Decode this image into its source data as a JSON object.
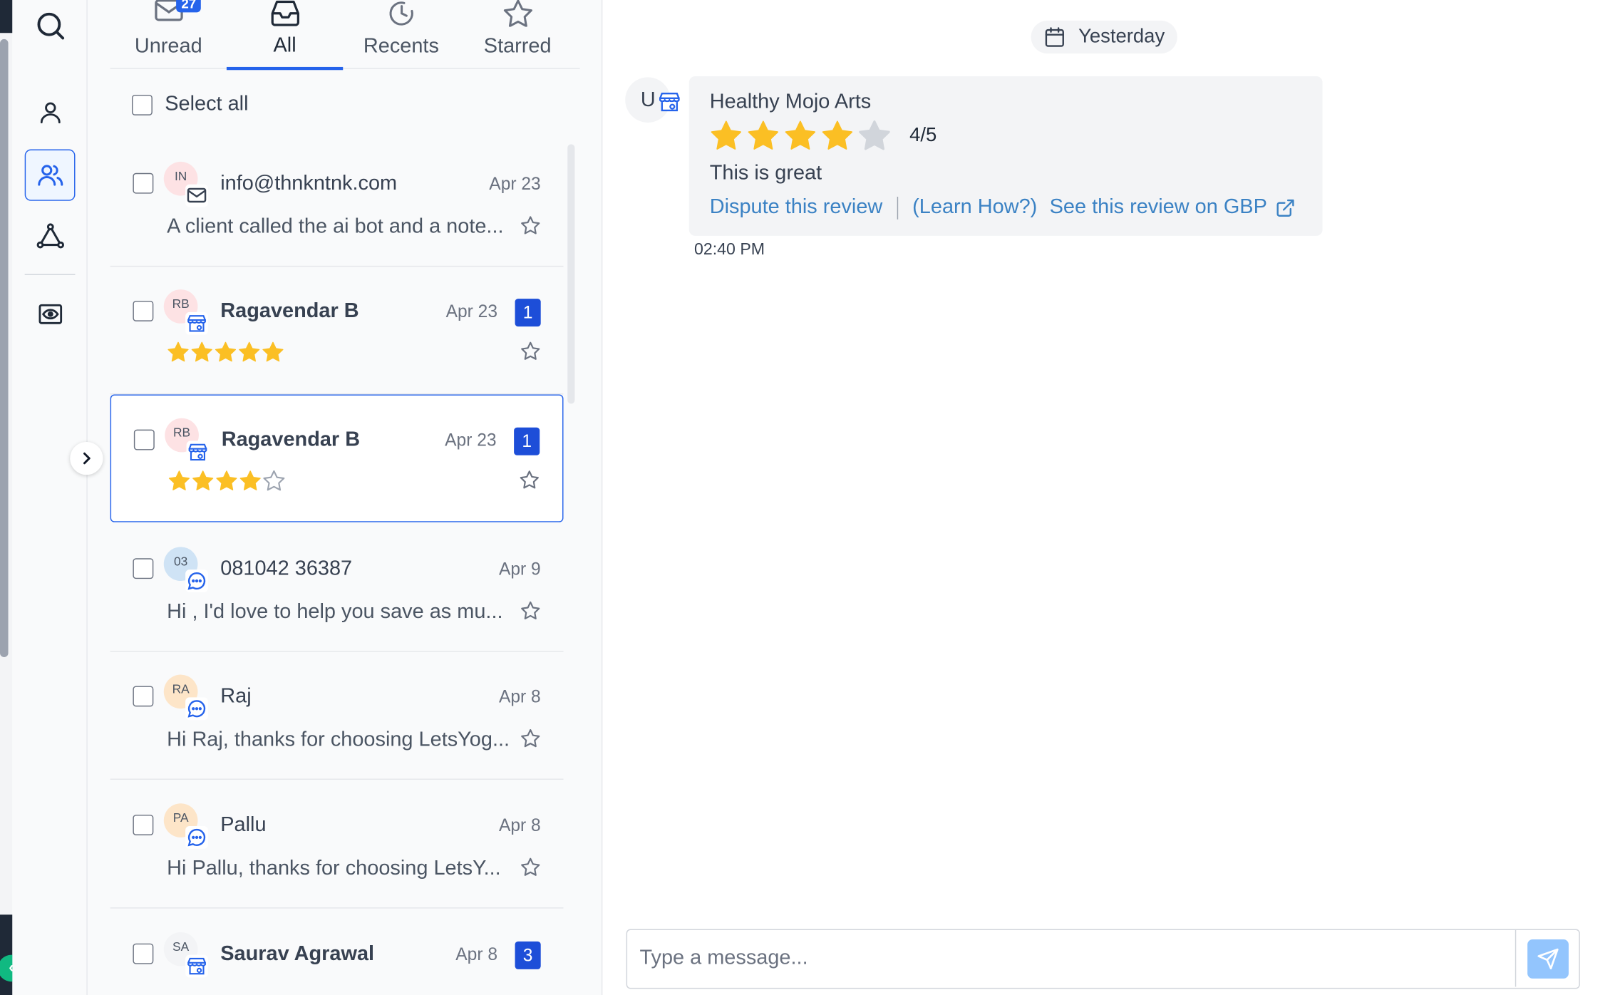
{
  "nav": {
    "icons": [
      "search-icon",
      "user-icon",
      "users-icon",
      "network-icon",
      "eye-icon"
    ],
    "active": "users-icon",
    "accent": "#2563eb"
  },
  "tabs": [
    {
      "label": "Unread",
      "badge": "27",
      "icon": "mail-icon"
    },
    {
      "label": "All",
      "icon": "inbox-icon",
      "active": true
    },
    {
      "label": "Recents",
      "icon": "clock-icon"
    },
    {
      "label": "Starred",
      "icon": "star-icon"
    }
  ],
  "select_all_label": "Select all",
  "conversations": [
    {
      "initials": "IN",
      "name": "info@thnkntnk.com",
      "date": "Apr 23",
      "preview": "A client called the ai bot and a note...",
      "channel": "mail-icon",
      "avatar_color": "#fde2e4"
    },
    {
      "initials": "RB",
      "name": "Ragavendar B",
      "date": "Apr 23",
      "count": "1",
      "rating": 5,
      "channel": "store-icon",
      "avatar_color": "#fde2e4"
    },
    {
      "initials": "RB",
      "name": "Ragavendar B",
      "date": "Apr 23",
      "count": "1",
      "rating": 4,
      "channel": "store-icon",
      "avatar_color": "#fde2e4"
    },
    {
      "initials": "03",
      "name": "081042 36387",
      "date": "Apr 9",
      "preview": "Hi , I'd love to help you save as mu...",
      "channel": "chat-icon",
      "avatar_color": "#cfe3f5"
    },
    {
      "initials": "RA",
      "name": "Raj",
      "date": "Apr 8",
      "preview": "Hi Raj, thanks for choosing LetsYog...",
      "channel": "chat-icon",
      "avatar_color": "#fde5c8"
    },
    {
      "initials": "PA",
      "name": "Pallu",
      "date": "Apr 8",
      "preview": "Hi Pallu, thanks for choosing LetsY...",
      "channel": "chat-icon",
      "avatar_color": "#fde5c8"
    },
    {
      "initials": "SA",
      "name": "Saurav Agrawal",
      "date": "Apr 8",
      "count": "3",
      "channel": "store-icon",
      "avatar_color": "#f3f4f6"
    }
  ],
  "chat": {
    "date_label": "Yesterday",
    "sender_initial": "U",
    "review": {
      "business": "Healthy Mojo Arts",
      "rating": 4,
      "rating_label": "4/5",
      "text": "This is great",
      "dispute_label": "Dispute this review",
      "learn_label": "(Learn How?)",
      "gbp_label": "See this review on GBP"
    },
    "time": "02:40 PM",
    "composer_placeholder": "Type a message..."
  },
  "colors": {
    "star": "#fbbf24",
    "star_empty": "#d1d5db",
    "link": "#3b82c4",
    "count_badge": "#1d4ed8"
  }
}
